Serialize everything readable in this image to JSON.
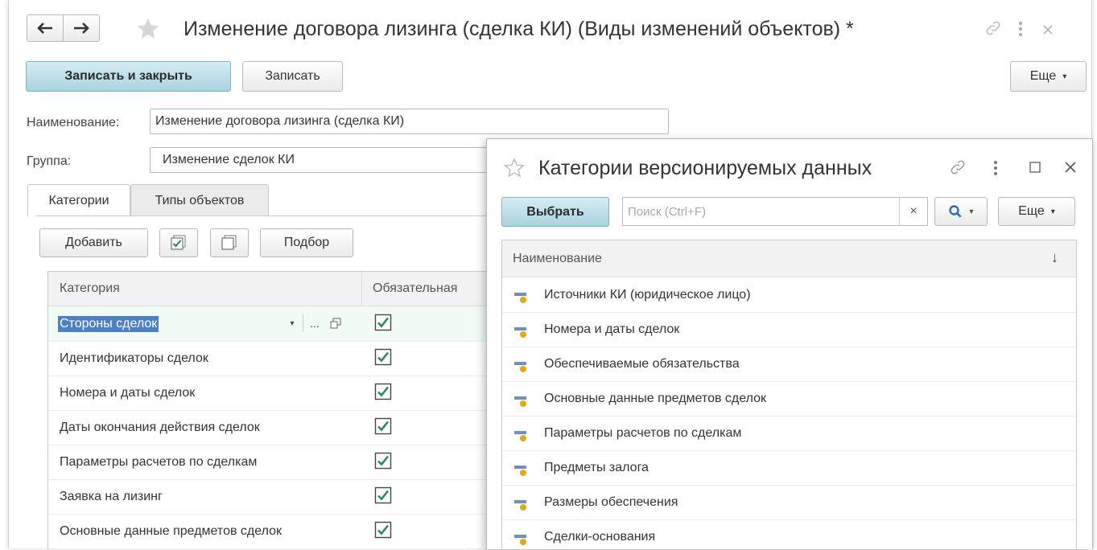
{
  "main": {
    "title": "Изменение договора лизинга (сделка КИ) (Виды изменений объектов) *",
    "toolbar": {
      "save_close": "Записать и закрыть",
      "save": "Записать",
      "more": "Еще"
    },
    "name_label": "Наименование:",
    "name_value": "Изменение договора лизинга (сделка КИ)",
    "group_label": "Группа:",
    "group_value": "Изменение сделок КИ",
    "tabs": [
      {
        "label": "Категории"
      },
      {
        "label": "Типы объектов"
      }
    ],
    "table_toolbar": {
      "add": "Добавить",
      "pick": "Подбор"
    },
    "columns": [
      "Категория",
      "Обязательная"
    ],
    "rows": [
      {
        "name": "Стороны сделок",
        "required": true
      },
      {
        "name": "Идентификаторы сделок",
        "required": true
      },
      {
        "name": "Номера и даты сделок",
        "required": true
      },
      {
        "name": "Даты окончания действия сделок",
        "required": true
      },
      {
        "name": "Параметры расчетов по сделкам",
        "required": true
      },
      {
        "name": "Заявка на лизинг",
        "required": true
      },
      {
        "name": "Основные данные предметов сделок",
        "required": true
      }
    ],
    "editor_ellipsis": "..."
  },
  "popup": {
    "title": "Категории версионируемых данных",
    "select": "Выбрать",
    "search_placeholder": "Поиск (Ctrl+F)",
    "search_clear": "×",
    "more": "Еще",
    "column": "Наименование",
    "sort_glyph": "↓",
    "items": [
      "Источники КИ (юридическое лицо)",
      "Номера и даты сделок",
      "Обеспечиваемые обязательства",
      "Основные данные предметов сделок",
      "Параметры расчетов по сделкам",
      "Предметы залога",
      "Размеры обеспечения",
      "Сделки-основания"
    ]
  },
  "colors": {
    "primary_button": "#a8d3df",
    "selection": "#4f7fc3",
    "check": "#2e8b57",
    "item_icon_bar": "#6e8fb8",
    "item_icon_dot": "#e0a91c"
  }
}
